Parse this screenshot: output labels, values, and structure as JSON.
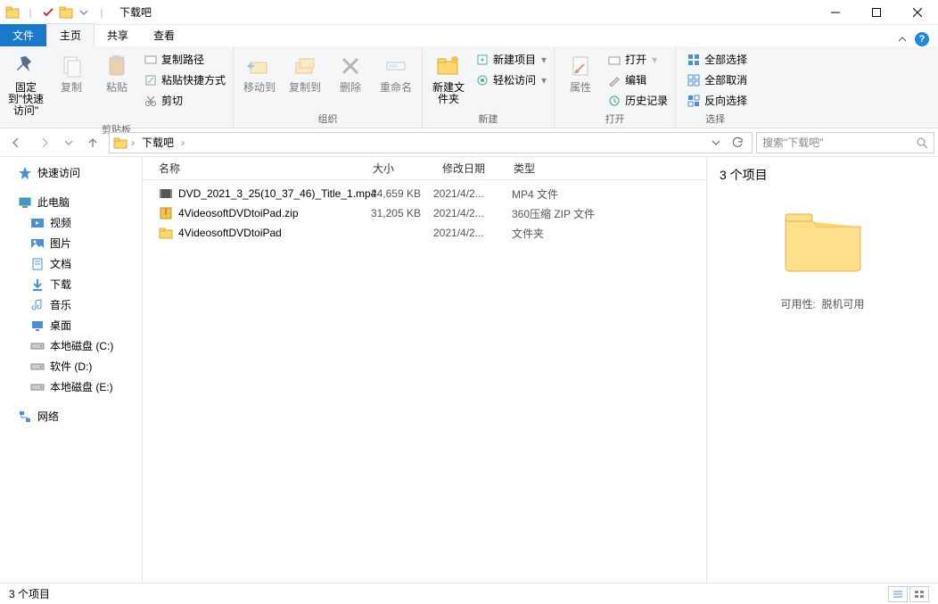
{
  "title": "下载吧",
  "tabs": {
    "file": "文件",
    "home": "主页",
    "share": "共享",
    "view": "查看"
  },
  "ribbon": {
    "pin": "固定到\"快速访问\"",
    "copy": "复制",
    "paste": "粘贴",
    "copy_path": "复制路径",
    "paste_shortcut": "粘贴快捷方式",
    "cut": "剪切",
    "clipboard_group": "剪贴板",
    "move_to": "移动到",
    "copy_to": "复制到",
    "delete": "删除",
    "rename": "重命名",
    "organize_group": "组织",
    "new_folder": "新建文件夹",
    "new_item": "新建项目",
    "easy_access": "轻松访问",
    "new_group": "新建",
    "properties": "属性",
    "open": "打开",
    "edit": "编辑",
    "history": "历史记录",
    "open_group": "打开",
    "select_all": "全部选择",
    "select_none": "全部取消",
    "invert_sel": "反向选择",
    "select_group": "选择"
  },
  "address": {
    "root": "下载吧"
  },
  "search_placeholder": "搜索\"下载吧\"",
  "nav": {
    "quick_access": "快速访问",
    "this_pc": "此电脑",
    "videos": "视频",
    "pictures": "图片",
    "documents": "文档",
    "downloads": "下载",
    "music": "音乐",
    "desktop": "桌面",
    "disk_c": "本地磁盘 (C:)",
    "disk_d": "软件 (D:)",
    "disk_e": "本地磁盘 (E:)",
    "network": "网络"
  },
  "columns": {
    "name": "名称",
    "size": "大小",
    "date": "修改日期",
    "type": "类型"
  },
  "files": [
    {
      "name": "DVD_2021_3_25(10_37_46)_Title_1.mp4",
      "size": "24,659 KB",
      "date": "2021/4/2...",
      "type": "MP4 文件",
      "icon": "video"
    },
    {
      "name": "4VideosoftDVDtoiPad.zip",
      "size": "31,205 KB",
      "date": "2021/4/2...",
      "type": "360压缩 ZIP 文件",
      "icon": "zip"
    },
    {
      "name": "4VideosoftDVDtoiPad",
      "size": "",
      "date": "2021/4/2...",
      "type": "文件夹",
      "icon": "folder"
    }
  ],
  "preview": {
    "count_label": "3 个项目",
    "availability_key": "可用性:",
    "availability_val": "脱机可用"
  },
  "status": {
    "count": "3 个项目"
  }
}
